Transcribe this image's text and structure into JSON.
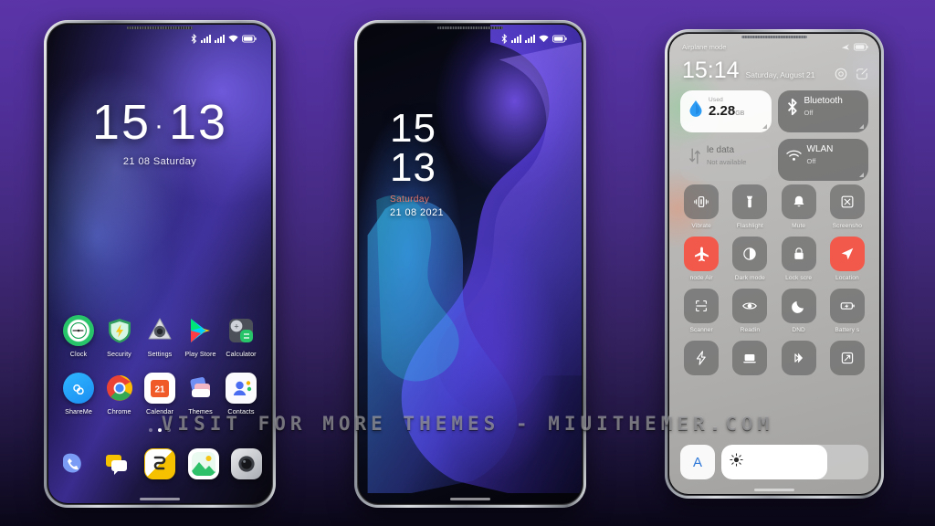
{
  "watermark": "VISIT  FOR  MORE  THEMES  -  MIUITHEMER.COM",
  "background_color": "#51309b",
  "phone1": {
    "name": "home-screen-phone",
    "statusbar": {
      "icons": [
        "bluetooth-icon",
        "signal-icon",
        "signal-icon",
        "wifi-icon",
        "battery-icon"
      ]
    },
    "clock": {
      "hour": "15",
      "separator": "·",
      "minute": "13",
      "date": "21 08 Saturday"
    },
    "apps_row1": [
      {
        "label": "Clock",
        "icon": "clock-icon"
      },
      {
        "label": "Security",
        "icon": "shield-icon"
      },
      {
        "label": "Settings",
        "icon": "gear-icon"
      },
      {
        "label": "Play Store",
        "icon": "play-store-icon"
      },
      {
        "label": "Calculator",
        "icon": "calculator-icon"
      }
    ],
    "apps_row2": [
      {
        "label": "ShareMe",
        "icon": "shareme-icon"
      },
      {
        "label": "Chrome",
        "icon": "chrome-icon"
      },
      {
        "label": "Calendar",
        "icon": "calendar-icon",
        "day": "21"
      },
      {
        "label": "Themes",
        "icon": "themes-icon"
      },
      {
        "label": "Contacts",
        "icon": "contacts-icon"
      }
    ],
    "page_dots": 3,
    "page_active": 1,
    "dock": [
      {
        "name": "phone-icon"
      },
      {
        "name": "messages-icon"
      },
      {
        "name": "browser-icon"
      },
      {
        "name": "gallery-icon"
      },
      {
        "name": "camera-icon"
      }
    ]
  },
  "phone2": {
    "name": "lock-screen-phone",
    "statusbar": {
      "icons": [
        "bluetooth-icon",
        "signal-icon",
        "signal-icon",
        "wifi-icon",
        "battery-icon"
      ]
    },
    "clock": {
      "hour": "15",
      "minute": "13",
      "weekday": "Saturday",
      "date": "21 08 2021",
      "weekday_color": "#e8776b"
    }
  },
  "phone3": {
    "name": "control-center-phone",
    "statusbar": {
      "airplane_label": "Airplane mode",
      "icons": [
        "airplane-icon",
        "battery-icon"
      ]
    },
    "header": {
      "time": "15:14",
      "date": "Saturday, August 21",
      "icons": [
        "settings-gear-icon",
        "edit-icon"
      ]
    },
    "cards": [
      {
        "name": "data-usage-card",
        "sub": "Used",
        "value": "2.28",
        "unit": "GB",
        "icon": "water-drop-icon",
        "style": "light"
      },
      {
        "name": "bluetooth-card",
        "title": "Bluetooth",
        "sub": "Off",
        "icon": "bluetooth-icon",
        "style": "dark"
      },
      {
        "name": "mobile-data-card",
        "title": "le data",
        "sub": "Not available",
        "icon": "data-arrows-icon",
        "style": "dim"
      },
      {
        "name": "wlan-card",
        "title": "WLAN",
        "sub": "Off",
        "icon": "wifi-icon",
        "style": "dark"
      }
    ],
    "toggles": [
      {
        "label": "Vibrate",
        "icon": "vibrate-icon",
        "on": false
      },
      {
        "label": "Flashlight",
        "icon": "flashlight-icon",
        "on": false
      },
      {
        "label": "Mute",
        "icon": "bell-icon",
        "on": false
      },
      {
        "label": "Screensho",
        "icon": "screenshot-icon",
        "on": false
      },
      {
        "label": "node   Air",
        "icon": "airplane-icon",
        "on": true
      },
      {
        "label": "Dark mode",
        "icon": "dark-mode-icon",
        "on": false
      },
      {
        "label": "Lock scre",
        "icon": "lock-icon",
        "on": false
      },
      {
        "label": "Location",
        "icon": "location-icon",
        "on": true
      },
      {
        "label": "Scanner",
        "icon": "scanner-icon",
        "on": false
      },
      {
        "label": "Readin",
        "icon": "eye-icon",
        "on": false
      },
      {
        "label": "DND",
        "icon": "moon-icon",
        "on": false
      },
      {
        "label": "Battery s",
        "icon": "battery-saver-icon",
        "on": false
      },
      {
        "label": "",
        "icon": "power-bolt-icon",
        "on": false
      },
      {
        "label": "",
        "icon": "cast-icon",
        "on": false
      },
      {
        "label": "",
        "icon": "sync-icon",
        "on": false
      },
      {
        "label": "",
        "icon": "expand-icon",
        "on": false
      }
    ],
    "brightness": {
      "auto_label": "A",
      "level_percent": 72,
      "icon": "sun-icon"
    },
    "accent_color": "#f2594b"
  }
}
